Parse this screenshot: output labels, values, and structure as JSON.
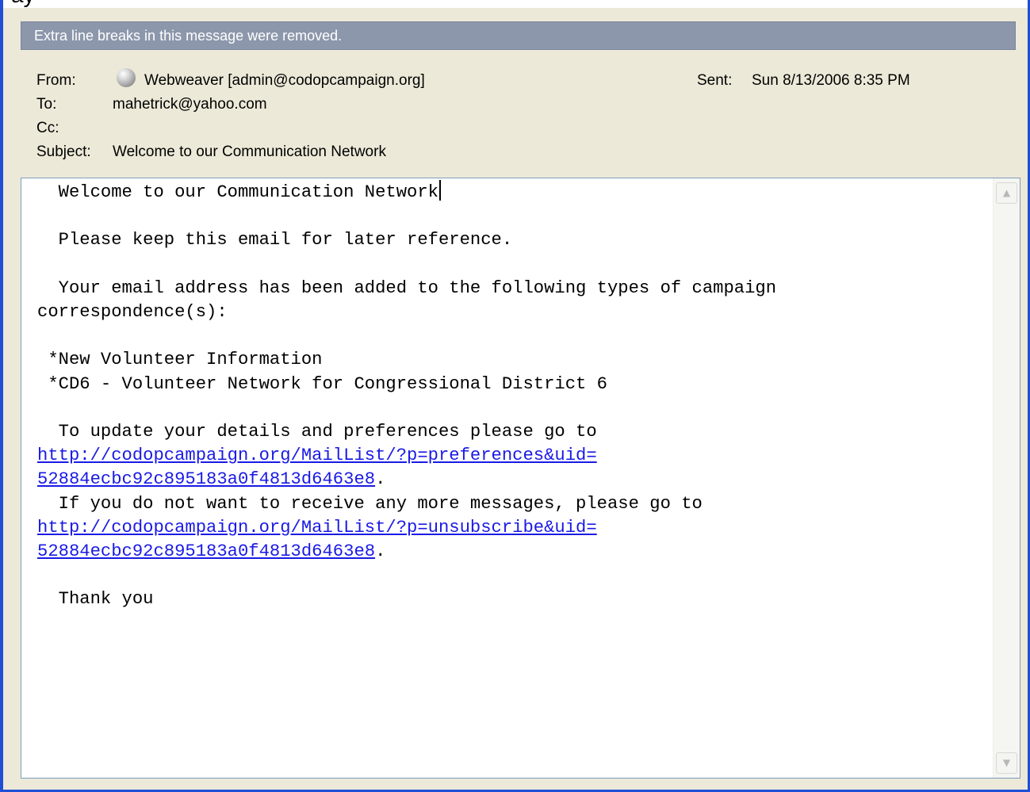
{
  "window": {
    "top_partial_text": "ay"
  },
  "infobar": {
    "text": "Extra line breaks in this message were removed."
  },
  "header": {
    "from_label": "From:",
    "from_value": "Webweaver [admin@codopcampaign.org]",
    "to_label": "To:",
    "to_value": "mahetrick@yahoo.com",
    "cc_label": "Cc:",
    "cc_value": "",
    "subject_label": "Subject:",
    "subject_value": "Welcome to our Communication Network",
    "sent_label": "Sent:",
    "sent_value": "Sun 8/13/2006 8:35 PM",
    "sender_icon": "contact-status-icon"
  },
  "body": {
    "line1": "  Welcome to our Communication Network",
    "line2": "  Please keep this email for later reference.",
    "line3": "  Your email address has been added to the following types of campaign",
    "line4": "correspondence(s):",
    "item1": " *New Volunteer Information",
    "item2": " *CD6 - Volunteer Network for Congressional District 6",
    "update_text": "  To update your details and preferences please go to",
    "preferences_link_1": "http://codopcampaign.org/MailList/?p=preferences&uid=",
    "preferences_link_2": "52884ecbc92c895183a0f4813d6463e8",
    "unsubscribe_text": "  If you do not want to receive any more messages, please go to",
    "unsubscribe_link_1": "http://codopcampaign.org/MailList/?p=unsubscribe&uid=",
    "unsubscribe_link_2": "52884ecbc92c895183a0f4813d6463e8",
    "period": ".",
    "closing": "  Thank you"
  },
  "scrollbar": {
    "up_icon": "scroll-up-arrow-icon",
    "down_icon": "scroll-down-arrow-icon"
  }
}
